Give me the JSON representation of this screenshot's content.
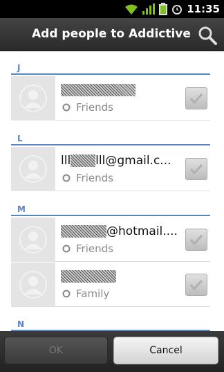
{
  "status_bar": {
    "time": "11:35",
    "icons": [
      "wifi-icon",
      "signal-icon",
      "battery-icon",
      "alarm-icon"
    ]
  },
  "header": {
    "title": "Add people to Addictive...",
    "search_icon": "search-icon"
  },
  "sections": [
    {
      "letter": "J",
      "contacts": [
        {
          "name_suffix": "",
          "group": "Friends",
          "checked": false
        }
      ]
    },
    {
      "letter": "L",
      "contacts": [
        {
          "name_prefix": "lll",
          "name_suffix": "lll@gmail.c...",
          "group": "Friends",
          "checked": false
        }
      ]
    },
    {
      "letter": "M",
      "contacts": [
        {
          "name_suffix": "@hotmail....",
          "group": "Friends",
          "checked": false
        },
        {
          "name_suffix": "",
          "group": "Family",
          "checked": false
        }
      ]
    },
    {
      "letter": "N",
      "contacts": []
    }
  ],
  "buttons": {
    "ok": "OK",
    "cancel": "Cancel"
  },
  "colors": {
    "section_accent": "#5a84c8",
    "title_bar": "#333333",
    "status_bar": "#000000"
  }
}
